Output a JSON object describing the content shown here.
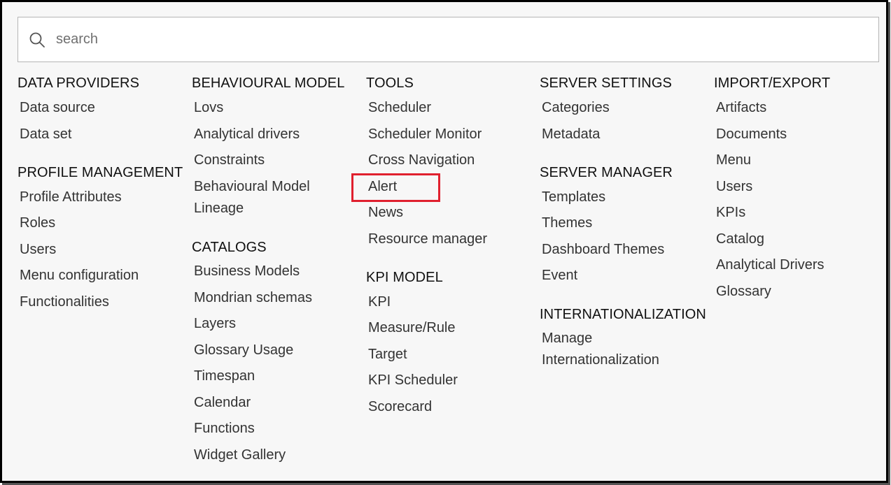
{
  "search": {
    "placeholder": "search"
  },
  "columns": [
    {
      "sections": [
        {
          "title": "DATA PROVIDERS",
          "items": [
            "Data source",
            "Data set"
          ]
        },
        {
          "title": "PROFILE MANAGEMENT",
          "items": [
            "Profile Attributes",
            "Roles",
            "Users",
            "Menu configuration",
            "Functionalities"
          ]
        }
      ]
    },
    {
      "sections": [
        {
          "title": "BEHAVIOURAL MODEL",
          "items": [
            "Lovs",
            "Analytical drivers",
            "Constraints",
            "Behavioural Model Lineage"
          ]
        },
        {
          "title": "CATALOGS",
          "items": [
            "Business Models",
            "Mondrian schemas",
            "Layers",
            "Glossary Usage",
            "Timespan",
            "Calendar",
            "Functions",
            "Widget Gallery"
          ]
        }
      ]
    },
    {
      "sections": [
        {
          "title": "TOOLS",
          "items": [
            "Scheduler",
            "Scheduler Monitor",
            "Cross Navigation",
            "Alert",
            "News",
            "Resource manager"
          ]
        },
        {
          "title": "KPI MODEL",
          "items": [
            "KPI",
            "Measure/Rule",
            "Target",
            "KPI Scheduler",
            "Scorecard"
          ]
        }
      ]
    },
    {
      "sections": [
        {
          "title": "SERVER SETTINGS",
          "items": [
            "Categories",
            "Metadata"
          ]
        },
        {
          "title": "SERVER MANAGER",
          "items": [
            "Templates",
            "Themes",
            "Dashboard Themes",
            "Event"
          ]
        },
        {
          "title": "INTERNATIONALIZATION",
          "items": [
            "Manage Internationalization"
          ]
        }
      ]
    },
    {
      "sections": [
        {
          "title": "IMPORT/EXPORT",
          "items": [
            "Artifacts",
            "Documents",
            "Menu",
            "Users",
            "KPIs",
            "Catalog",
            "Analytical Drivers",
            "Glossary"
          ]
        }
      ]
    }
  ],
  "highlight": {
    "item": "Alert",
    "color": "#e0202e"
  }
}
